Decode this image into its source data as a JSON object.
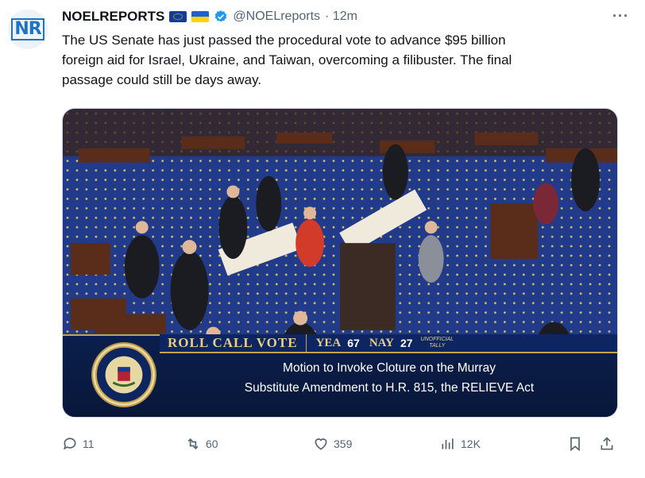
{
  "account": {
    "avatar_text": "NR",
    "name": "NOELREPORTS",
    "handle": "@NOELreports",
    "time": "· 12m"
  },
  "tweet": {
    "text_lines": [
      "The US Senate has just passed the procedural vote to advance $95 billion",
      "foreign aid for Israel, Ukraine, and Taiwan, overcoming a filibuster. The final",
      "passage could still be days away."
    ]
  },
  "media": {
    "banner_title": "ROLL CALL VOTE",
    "yea_label": "YEA",
    "yea_count": "67",
    "nay_label": "NAY",
    "nay_count": "27",
    "tally_line1": "UNOFFICIAL",
    "tally_line2": "TALLY",
    "motion_line1": "Motion to Invoke Cloture on the Murray",
    "motion_line2": "Substitute Amendment to  H.R. 815, the RELIEVE Act"
  },
  "actions": {
    "reply_count": "11",
    "repost_count": "60",
    "like_count": "359",
    "views_count": "12K"
  },
  "colors": {
    "accent": "#1d9bf0",
    "banner_navy": "#0b1f4d",
    "banner_gold": "#e8cf86",
    "muted": "#536471"
  }
}
